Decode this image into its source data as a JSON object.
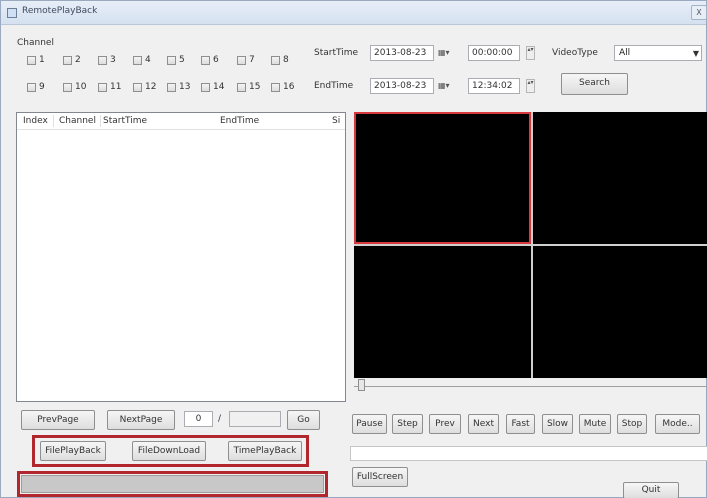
{
  "window": {
    "title": "RemotePlayBack",
    "close_label": "X"
  },
  "channel": {
    "label": "Channel",
    "items": [
      "1",
      "2",
      "3",
      "4",
      "5",
      "6",
      "7",
      "8",
      "9",
      "10",
      "11",
      "12",
      "13",
      "14",
      "15",
      "16"
    ]
  },
  "search": {
    "start_time_label": "StartTime",
    "start_date": "2013-08-23",
    "start_time": "00:00:00",
    "end_time_label": "EndTime",
    "end_date": "2013-08-23",
    "end_time": "12:34:02",
    "video_type_label": "VideoType",
    "video_type_value": "All",
    "search_button": "Search",
    "calendar_glyph": "▦▾",
    "spin_glyph": "▴▾"
  },
  "list": {
    "columns": [
      "Index",
      "Channel",
      "StartTime",
      "EndTime",
      "Si"
    ]
  },
  "paging": {
    "prev_label": "PrevPage",
    "next_label": "NextPage",
    "current_page": "0",
    "separator": "/",
    "total_pages": "",
    "go_label": "Go"
  },
  "playback_modes": {
    "file_playback": "FilePlayBack",
    "file_download": "FileDownLoad",
    "time_playback": "TimePlayBack"
  },
  "controls": {
    "pause": "Pause",
    "step": "Step",
    "prev": "Prev",
    "next": "Next",
    "fast": "Fast",
    "slow": "Slow",
    "mute": "Mute",
    "stop": "Stop",
    "mode": "Mode..",
    "fullscreen": "FullScreen",
    "quit": "Quit"
  },
  "colors": {
    "highlight_frame": "#b2262d",
    "active_pane_border": "#d7393e",
    "video_background": "#000000"
  }
}
